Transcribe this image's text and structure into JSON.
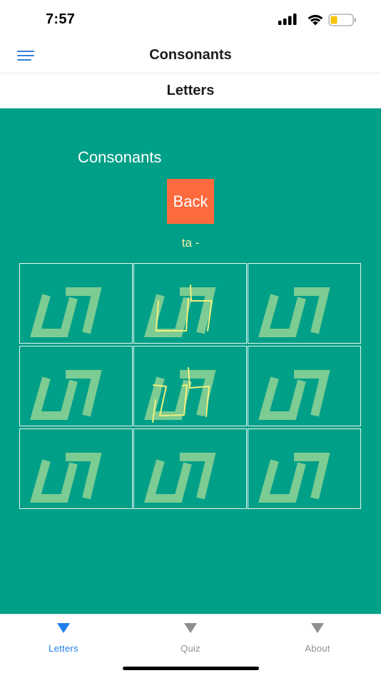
{
  "status_bar": {
    "time": "7:57",
    "icons": [
      "signal-icon",
      "wifi-icon",
      "battery-icon"
    ],
    "battery_color": "#f6c40b"
  },
  "nav_bar": {
    "title": "Consonants",
    "menu_icon": "hamburger-menu-icon",
    "accent_color": "#2f7fdd"
  },
  "section_header": {
    "title": "Letters"
  },
  "main": {
    "background_color": "#009f87",
    "heading": "Consonants",
    "back_button": {
      "label": "Back",
      "color": "#fd6a3d"
    },
    "letter_label": "ta -",
    "grid": {
      "rows": 3,
      "columns": 3,
      "guide_glyph_color": "#7ccc93",
      "trace_color": "#f3f07d",
      "traced_cells": [
        2,
        5
      ]
    }
  },
  "tab_bar": {
    "active_color": "#1e7fea",
    "inactive_color": "#8e8e8e",
    "tabs": [
      {
        "label": "Letters",
        "icon": "triangle-down-icon",
        "active": true
      },
      {
        "label": "Quiz",
        "icon": "triangle-down-icon",
        "active": false
      },
      {
        "label": "About",
        "icon": "triangle-down-icon",
        "active": false
      }
    ]
  }
}
